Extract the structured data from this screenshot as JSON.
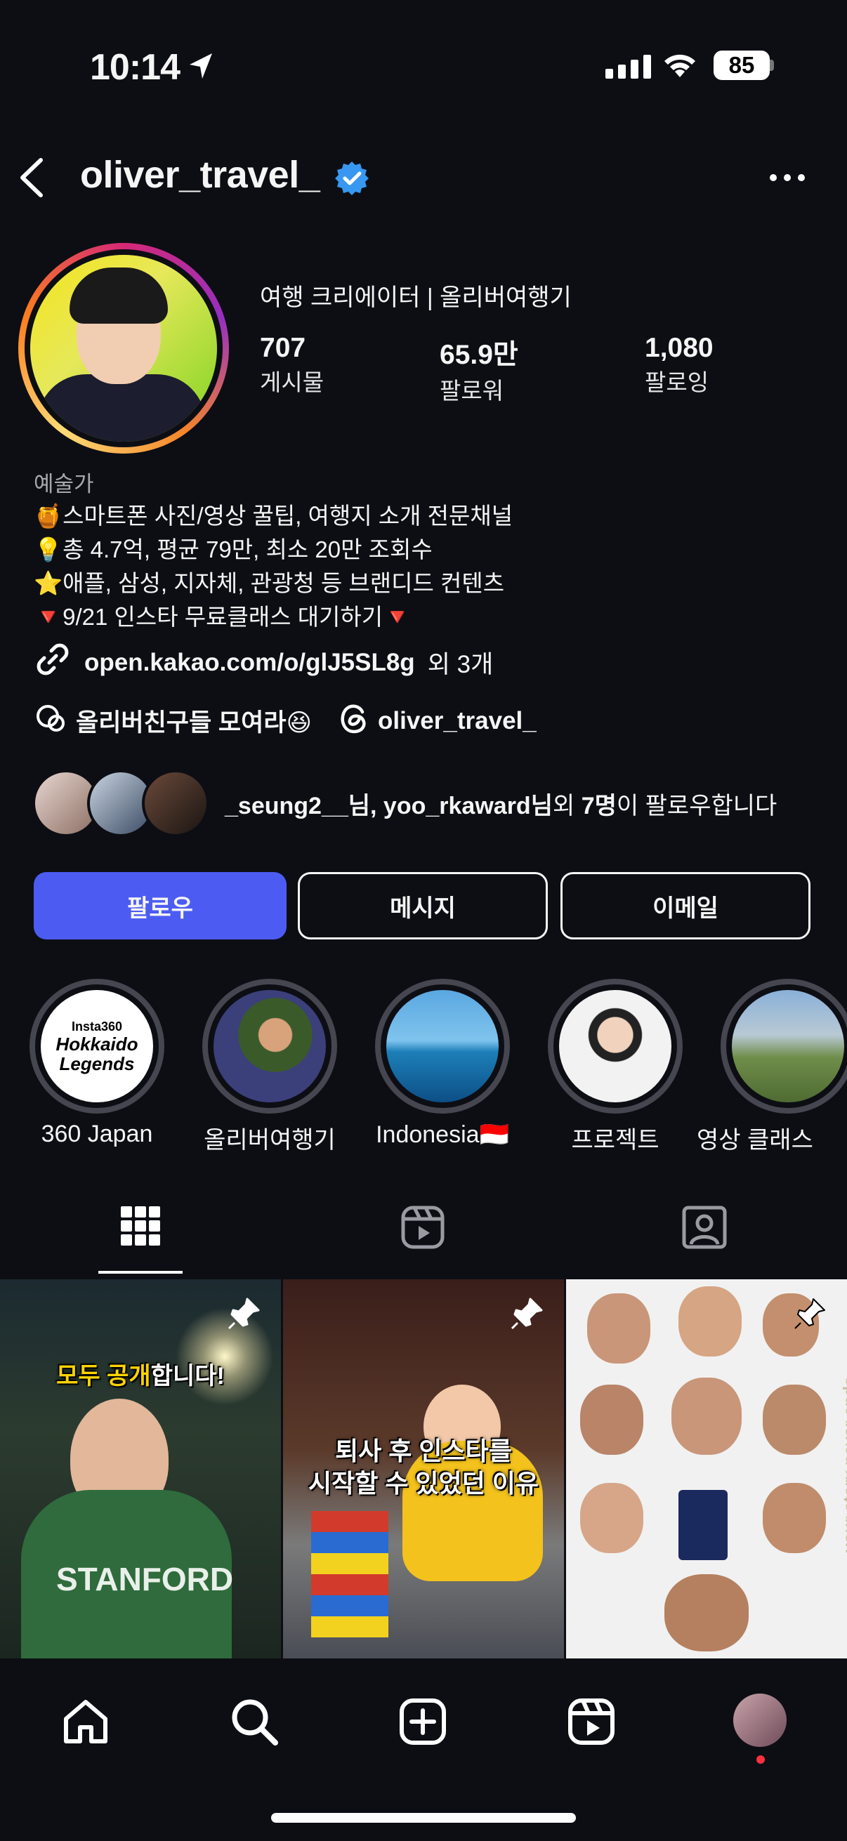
{
  "status_bar": {
    "time": "10:14",
    "battery": "85"
  },
  "header": {
    "username": "oliver_travel_"
  },
  "profile": {
    "display_name": "여행 크리에이터 | 올리버여행기",
    "stats": [
      {
        "value": "707",
        "label": "게시물"
      },
      {
        "value": "65.9만",
        "label": "팔로워"
      },
      {
        "value": "1,080",
        "label": "팔로잉"
      }
    ],
    "category": "예술가",
    "bio": [
      "🍯스마트폰 사진/영상 꿀팁, 여행지 소개 전문채널",
      "💡총 4.7억, 평균 79만, 최소 20만 조회수",
      "⭐애플, 삼성, 지자체, 관광청 등 브랜디드 컨텐츠",
      "🔻9/21 인스타 무료클래스 대기하기🔻"
    ],
    "link": {
      "url": "open.kakao.com/o/glJ5SL8g",
      "suffix": "외 3개"
    },
    "community": "올리버친구들 모여라😆",
    "threads": "oliver_travel_",
    "followed_by": {
      "names": "_seung2__님, yoo_rkaward님",
      "prefix": "외 ",
      "count": "7명",
      "suffix": "이 팔로우합니다"
    }
  },
  "buttons": {
    "follow": "팔로우",
    "message": "메시지",
    "email": "이메일"
  },
  "highlights": [
    {
      "label": "360 Japan",
      "cover_text_top": "Insta360",
      "cover_text_main": "Hokkaido Legends"
    },
    {
      "label": "올리버여행기"
    },
    {
      "label": "Indonesia🇮🇩"
    },
    {
      "label": "프로젝트"
    },
    {
      "label": "영상 클래스"
    }
  ],
  "posts": [
    {
      "caption_highlight": "모두 공개",
      "caption_rest": "합니다!",
      "shirt_text": "STANFORD"
    },
    {
      "caption_line1": "퇴사 후 인스타를",
      "caption_line2": "시작할 수 있었던 이유"
    },
    {
      "side_text": "your story never ends"
    }
  ],
  "colors": {
    "background": "#0d0e14",
    "follow_button": "#4c5cf3",
    "verified": "#3897f0"
  }
}
